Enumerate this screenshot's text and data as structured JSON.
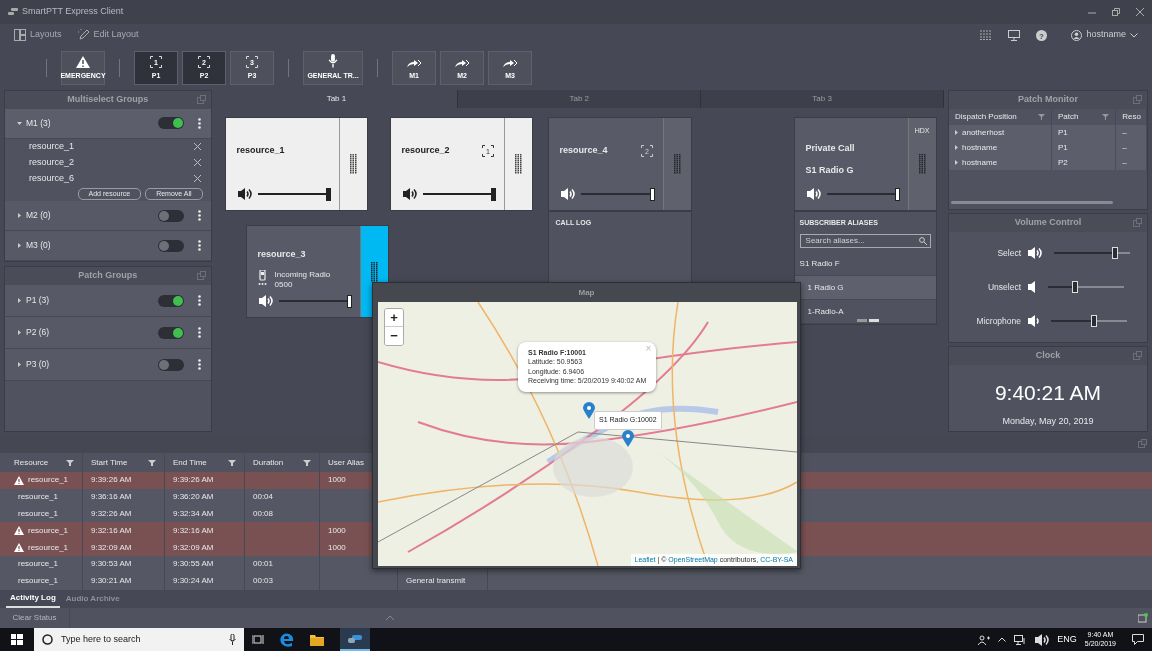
{
  "window": {
    "title": "SmartPTT Express Client"
  },
  "menu": {
    "help": "?",
    "items": [
      {
        "label": "Layouts",
        "kind": "layouts"
      },
      {
        "label": "Edit Layout",
        "kind": "edit"
      }
    ],
    "user": "hostname"
  },
  "toolbar": [
    {
      "label": "EMERGENCY",
      "kind": "emergency",
      "active": false
    },
    {
      "label": "P1",
      "kind": "patch",
      "number": "1",
      "active": true
    },
    {
      "label": "P2",
      "kind": "patch",
      "number": "2",
      "active": true
    },
    {
      "label": "P3",
      "kind": "patch",
      "number": "3",
      "active": false
    },
    {
      "label": "GENERAL TR...",
      "kind": "transmit",
      "active": false
    },
    {
      "label": "M1",
      "kind": "multiselect",
      "active": false
    },
    {
      "label": "M2",
      "kind": "multiselect",
      "active": false
    },
    {
      "label": "M3",
      "kind": "multiselect",
      "active": false
    }
  ],
  "multiselect_groups": {
    "title": "Multiselect Groups",
    "groups": [
      {
        "name": "M1 (3)",
        "expanded": true,
        "on": true,
        "members": [
          "resource_1",
          "resource_2",
          "resource_6"
        ],
        "buttons": [
          "Add resource",
          "Remove All"
        ]
      },
      {
        "name": "M2 (0)",
        "expanded": false,
        "on": false
      },
      {
        "name": "M3 (0)",
        "expanded": false,
        "on": false
      }
    ]
  },
  "patch_groups": {
    "title": "Patch Groups",
    "groups": [
      {
        "name": "P1 (3)",
        "expanded": false,
        "on": true
      },
      {
        "name": "P2 (6)",
        "expanded": false,
        "on": true
      },
      {
        "name": "P3 (0)",
        "expanded": false,
        "on": false
      }
    ]
  },
  "tabs": [
    {
      "label": "Tab 1",
      "selected": true
    },
    {
      "label": "Tab 2",
      "selected": false
    },
    {
      "label": "Tab 3",
      "selected": false
    }
  ],
  "tiles": [
    {
      "kind": "resource",
      "name": "resource_1",
      "selected": true,
      "receiving": false,
      "level": 1
    },
    {
      "kind": "resource",
      "name": "resource_2",
      "selected": true,
      "receiving": false,
      "patch": "1",
      "level": 1
    },
    {
      "kind": "resource",
      "name": "resource_4",
      "selected": false,
      "receiving": false,
      "patch": "2",
      "level": 1,
      "call_log": "CALL LOG"
    },
    {
      "kind": "private_call",
      "lines": [
        "Private Call",
        "S1 Radio G"
      ],
      "mode": "HDX",
      "selected": false,
      "receiving": false,
      "level": 1,
      "aliases": {
        "title": "SUBSCRIBER ALIASES",
        "placeholder": "Search aliases...",
        "items": [
          {
            "label": "S1 Radio F",
            "selected": false
          },
          {
            "label": "1 Radio G",
            "selected": true
          },
          {
            "label": "1-Radio-A",
            "selected": false
          }
        ]
      }
    },
    {
      "kind": "resource",
      "name": "resource_3",
      "selected": false,
      "receiving": true,
      "status": [
        "Incoming Radio",
        "0500"
      ],
      "level": 1
    }
  ],
  "map": {
    "title": "Map",
    "zoom": [
      "+",
      "−"
    ],
    "popup": {
      "title": "S1 Radio F:10001",
      "lines": [
        "Latitude: 50.9563",
        "Longitude: 6.9406",
        "Receiving time: 5/20/2019 9:40:02 AM"
      ],
      "close": "×"
    },
    "tooltip": "S1 Radio G:10002",
    "attribution": [
      {
        "text": "Leaflet",
        "link": true
      },
      {
        "text": " | © ",
        "link": false
      },
      {
        "text": "OpenStreetMap",
        "link": true
      },
      {
        "text": " contributors, ",
        "link": false
      },
      {
        "text": "CC-BY-SA",
        "link": true
      }
    ]
  },
  "patch_monitor": {
    "title": "Patch Monitor",
    "columns": [
      "Dispatch Position",
      "Patch",
      "Reso"
    ],
    "rows": [
      [
        "anotherhost",
        "P1",
        "–"
      ],
      [
        "hostname",
        "P1",
        "–"
      ],
      [
        "hostname",
        "P2",
        "–"
      ]
    ]
  },
  "volume_control": {
    "title": "Volume Control",
    "channels": [
      {
        "name": "Select",
        "level": 0.8
      },
      {
        "name": "Unselect",
        "level": 0.35
      },
      {
        "name": "Microphone",
        "level": 0.56
      }
    ]
  },
  "clock": {
    "title": "Clock",
    "time": "9:40:21 AM",
    "date": "Monday, May 20, 2019"
  },
  "activity_log": {
    "columns": [
      "Resource",
      "Start Time",
      "End Time",
      "Duration",
      "User Alias"
    ],
    "rows": [
      {
        "alert": true,
        "resource": "resource_1",
        "start": "9:39:26 AM",
        "end": "9:39:26 AM",
        "user_alias": "1000"
      },
      {
        "alert": false,
        "resource": "resource_1",
        "start": "9:36:16 AM",
        "end": "9:36:20 AM",
        "duration": "00:04"
      },
      {
        "alert": false,
        "resource": "resource_1",
        "start": "9:32:26 AM",
        "end": "9:32:34 AM",
        "duration": "00:08"
      },
      {
        "alert": true,
        "resource": "resource_1",
        "start": "9:32:16 AM",
        "end": "9:32:16 AM",
        "user_alias": "1000"
      },
      {
        "alert": true,
        "resource": "resource_1",
        "start": "9:32:09 AM",
        "end": "9:32:09 AM",
        "user_alias": "1000"
      },
      {
        "alert": false,
        "resource": "resource_1",
        "start": "9:30:53 AM",
        "end": "9:30:55 AM",
        "duration": "00:01"
      },
      {
        "alert": false,
        "resource": "resource_1",
        "start": "9:30:21 AM",
        "end": "9:30:24 AM",
        "duration": "00:03",
        "column_6": "General transmit"
      }
    ]
  },
  "bottom_tabs": [
    {
      "label": "Activity Log",
      "selected": true
    },
    {
      "label": "Audio Archive",
      "selected": false
    }
  ],
  "status_bar": {
    "button": "Clear Status"
  },
  "taskbar": {
    "search_placeholder": "Type here to search",
    "language": "ENG",
    "time": "9:40 AM",
    "date": "5/20/2019"
  }
}
